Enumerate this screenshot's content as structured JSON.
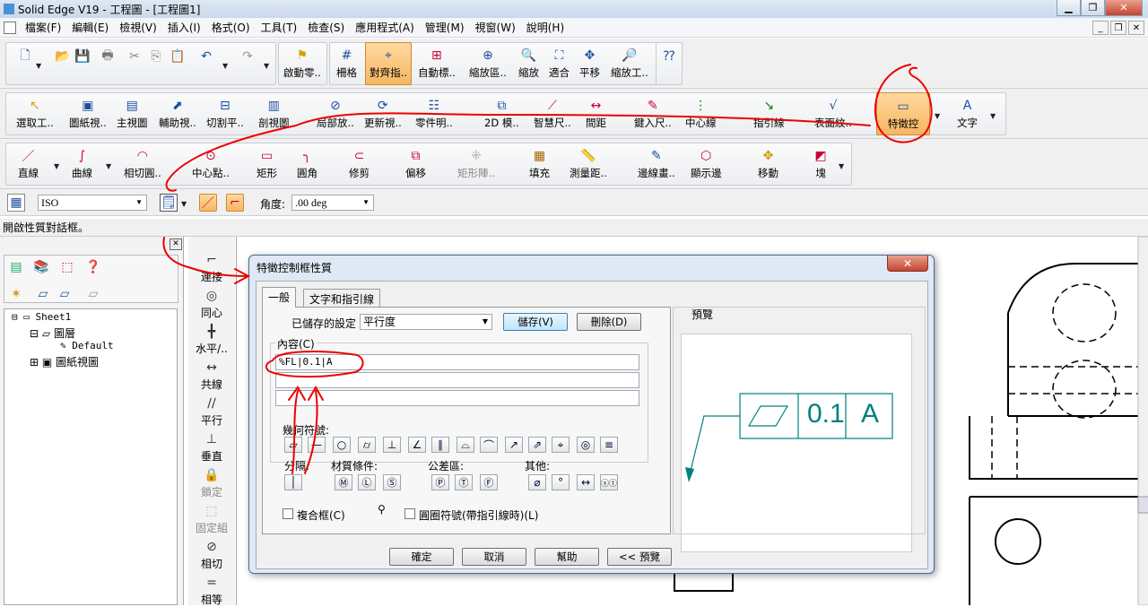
{
  "window": {
    "title": "Solid Edge V19 - 工程圖 - [工程圖1]"
  },
  "menu": [
    "檔案(F)",
    "編輯(E)",
    "檢視(V)",
    "插入(I)",
    "格式(O)",
    "工具(T)",
    "檢查(S)",
    "應用程式(A)",
    "管理(M)",
    "視窗(W)",
    "說明(H)"
  ],
  "toolbar1": {
    "buttons": [
      "啟動零..",
      "柵格",
      "對齊指..",
      "自動標..",
      "縮放區..",
      "縮放",
      "適合",
      "平移",
      "縮放工.."
    ]
  },
  "toolbar2": {
    "buttons": [
      "選取工..",
      "圖紙視..",
      "主視圖",
      "輔助視..",
      "切割平..",
      "剖視圖",
      "局部放..",
      "更新視..",
      "零件明..",
      "2D 模..",
      "智慧尺..",
      "間距",
      "鍵入尺..",
      "中心線",
      "指引線",
      "表面紋..",
      "特徵控",
      "文字"
    ]
  },
  "toolbar3": {
    "buttons": [
      "直線",
      "曲線",
      "相切圓..",
      "中心點..",
      "矩形",
      "圓角",
      "修剪",
      "偏移",
      "矩形陣..",
      "填充",
      "測量距..",
      "邊線畫..",
      "顯示邊",
      "移動",
      "塊"
    ]
  },
  "propbar": {
    "standard": "ISO",
    "angle_label": "角度:",
    "angle_value": ".00 deg"
  },
  "status": "開啟性質對話框。",
  "tree": {
    "root": "Sheet1",
    "layers": "圖層",
    "default": "Default",
    "views": "圖紙視圖"
  },
  "vtools": [
    "連接",
    "同心",
    "水平/..",
    "共線",
    "平行",
    "垂直",
    "鎖定",
    "固定組",
    "相切",
    "相等"
  ],
  "dialog": {
    "title": "特徵控制框性質",
    "tabs": [
      "一般",
      "文字和指引線"
    ],
    "saved_label": "已儲存的設定",
    "saved_value": "平行度",
    "save_btn": "儲存(V)",
    "delete_btn": "刪除(D)",
    "content_label": "內容(C)",
    "content_value": "%FL|0.1|A",
    "geom_label": "幾何符號:",
    "sep_label": "分隔:",
    "material_label": "材質條件:",
    "tol_label": "公差區:",
    "other_label": "其他:",
    "composite_label": "複合框(C)",
    "circle_label": "圓圈符號(帶指引線時)(L)",
    "preview_label": "預覽",
    "preview_value": "0.1",
    "preview_datum": "A",
    "ok": "確定",
    "cancel": "取消",
    "help": "幫助",
    "preview_btn": "<< 預覽"
  }
}
